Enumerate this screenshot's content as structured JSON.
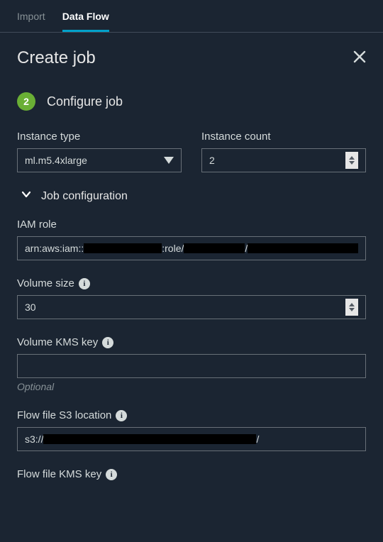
{
  "tabs": {
    "import": "Import",
    "dataFlow": "Data Flow"
  },
  "panel": {
    "title": "Create job"
  },
  "step": {
    "number": "2",
    "title": "Configure job"
  },
  "instanceType": {
    "label": "Instance type",
    "value": "ml.m5.4xlarge"
  },
  "instanceCount": {
    "label": "Instance count",
    "value": "2"
  },
  "jobConfig": {
    "label": "Job configuration"
  },
  "iamRole": {
    "label": "IAM role",
    "prefix": "arn:aws:iam::",
    "mid": ":role/",
    "sep": "/"
  },
  "volumeSize": {
    "label": "Volume size",
    "value": "30"
  },
  "volumeKms": {
    "label": "Volume KMS key",
    "value": "",
    "helper": "Optional"
  },
  "flowS3": {
    "label": "Flow file S3 location",
    "prefix": "s3://",
    "sep": "/"
  },
  "flowKms": {
    "label": "Flow file KMS key"
  }
}
